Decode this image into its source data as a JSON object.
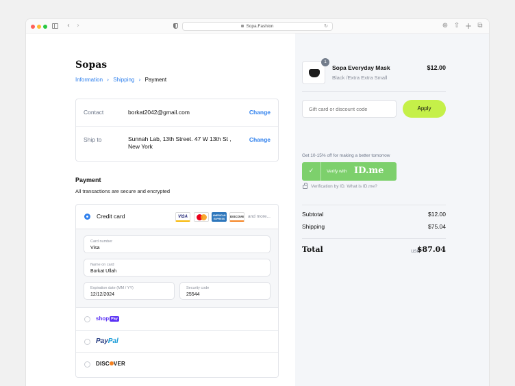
{
  "browser": {
    "url": "Sopa.Fashion",
    "icons": [
      "sidebar-icon",
      "back-icon",
      "forward-icon",
      "shield-icon",
      "lock-icon",
      "reload-icon",
      "download-icon",
      "share-icon",
      "new-tab-icon",
      "tabs-icon"
    ]
  },
  "brand": "Sopas",
  "breadcrumb": {
    "information": "Information",
    "shipping": "Shipping",
    "payment": "Payment"
  },
  "contact": {
    "label": "Contact",
    "value": "borkat2042@gmail.com",
    "change": "Change"
  },
  "ship_to": {
    "label": "Ship to",
    "value": "Sunnah Lab, 13th Street. 47 W 13th St , New York",
    "change": "Change"
  },
  "payment": {
    "title": "Payment",
    "subtitle": "All transactions are secure and encrypted",
    "credit_card_label": "Credit card",
    "card_logos": {
      "visa": "VISA",
      "amex": "AMERICAN EXPRESS",
      "discover": "DISCOVER"
    },
    "more": "and more...",
    "fields": {
      "card_number": {
        "label": "Card number",
        "value": "Visa"
      },
      "name": {
        "label": "Name on card",
        "value": "Borkat Ullah"
      },
      "expiry": {
        "label": "Expiration date (MM / YY)",
        "value": "12/12/2024"
      },
      "security": {
        "label": "Security code",
        "value": "25544"
      }
    },
    "alt_methods": {
      "shop": "shop",
      "shop_badge": "Pay",
      "paypal_pay": "Pay",
      "paypal_pal": "Pal",
      "discover_a": "DISC",
      "discover_b": "VER"
    }
  },
  "order": {
    "product_name": "Sopa Everyday Mask",
    "variant": "Black /Extra Extra Small",
    "price": "$12.00",
    "quantity": "1"
  },
  "discount": {
    "placeholder": "Gift card or discount code",
    "apply": "Apply"
  },
  "idme": {
    "promo": "Get 10-15% off for making a better tomorrow",
    "verify_with": "Verify with",
    "logo": "ID.me",
    "note": "Verification by ID. What is ID.me?"
  },
  "summary": {
    "subtotal_label": "Subtotal",
    "subtotal": "$12.00",
    "shipping_label": "Shipping",
    "shipping": "$75.04",
    "total_label": "Total",
    "currency": "usd",
    "total": "$87.04"
  },
  "colors": {
    "accent_blue": "#2f80ed",
    "apply_green": "#c5f049",
    "idme_green": "#7dd06c",
    "right_panel_bg": "#f4f6f9"
  }
}
